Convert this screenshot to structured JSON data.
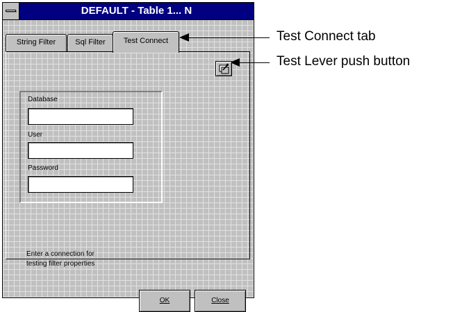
{
  "window": {
    "title": "DEFAULT - Table 1... N"
  },
  "tabs": [
    {
      "label": "String Filter",
      "active": false
    },
    {
      "label": "Sql Filter",
      "active": false
    },
    {
      "label": "Test Connect",
      "active": true
    }
  ],
  "form": {
    "database_label": "Database",
    "user_label": "User",
    "password_label": "Password",
    "database_value": "",
    "user_value": "",
    "password_value": ""
  },
  "hint": {
    "line1": "Enter a connection for",
    "line2": "testing filter properties"
  },
  "buttons": {
    "ok_label": "OK",
    "close_label": "Close"
  },
  "icons": {
    "system_menu": "system-menu-icon",
    "test_lever": "test-lever-icon"
  },
  "callouts": {
    "test_connect_tab": "Test Connect tab",
    "test_lever_button": "Test Lever push button"
  }
}
